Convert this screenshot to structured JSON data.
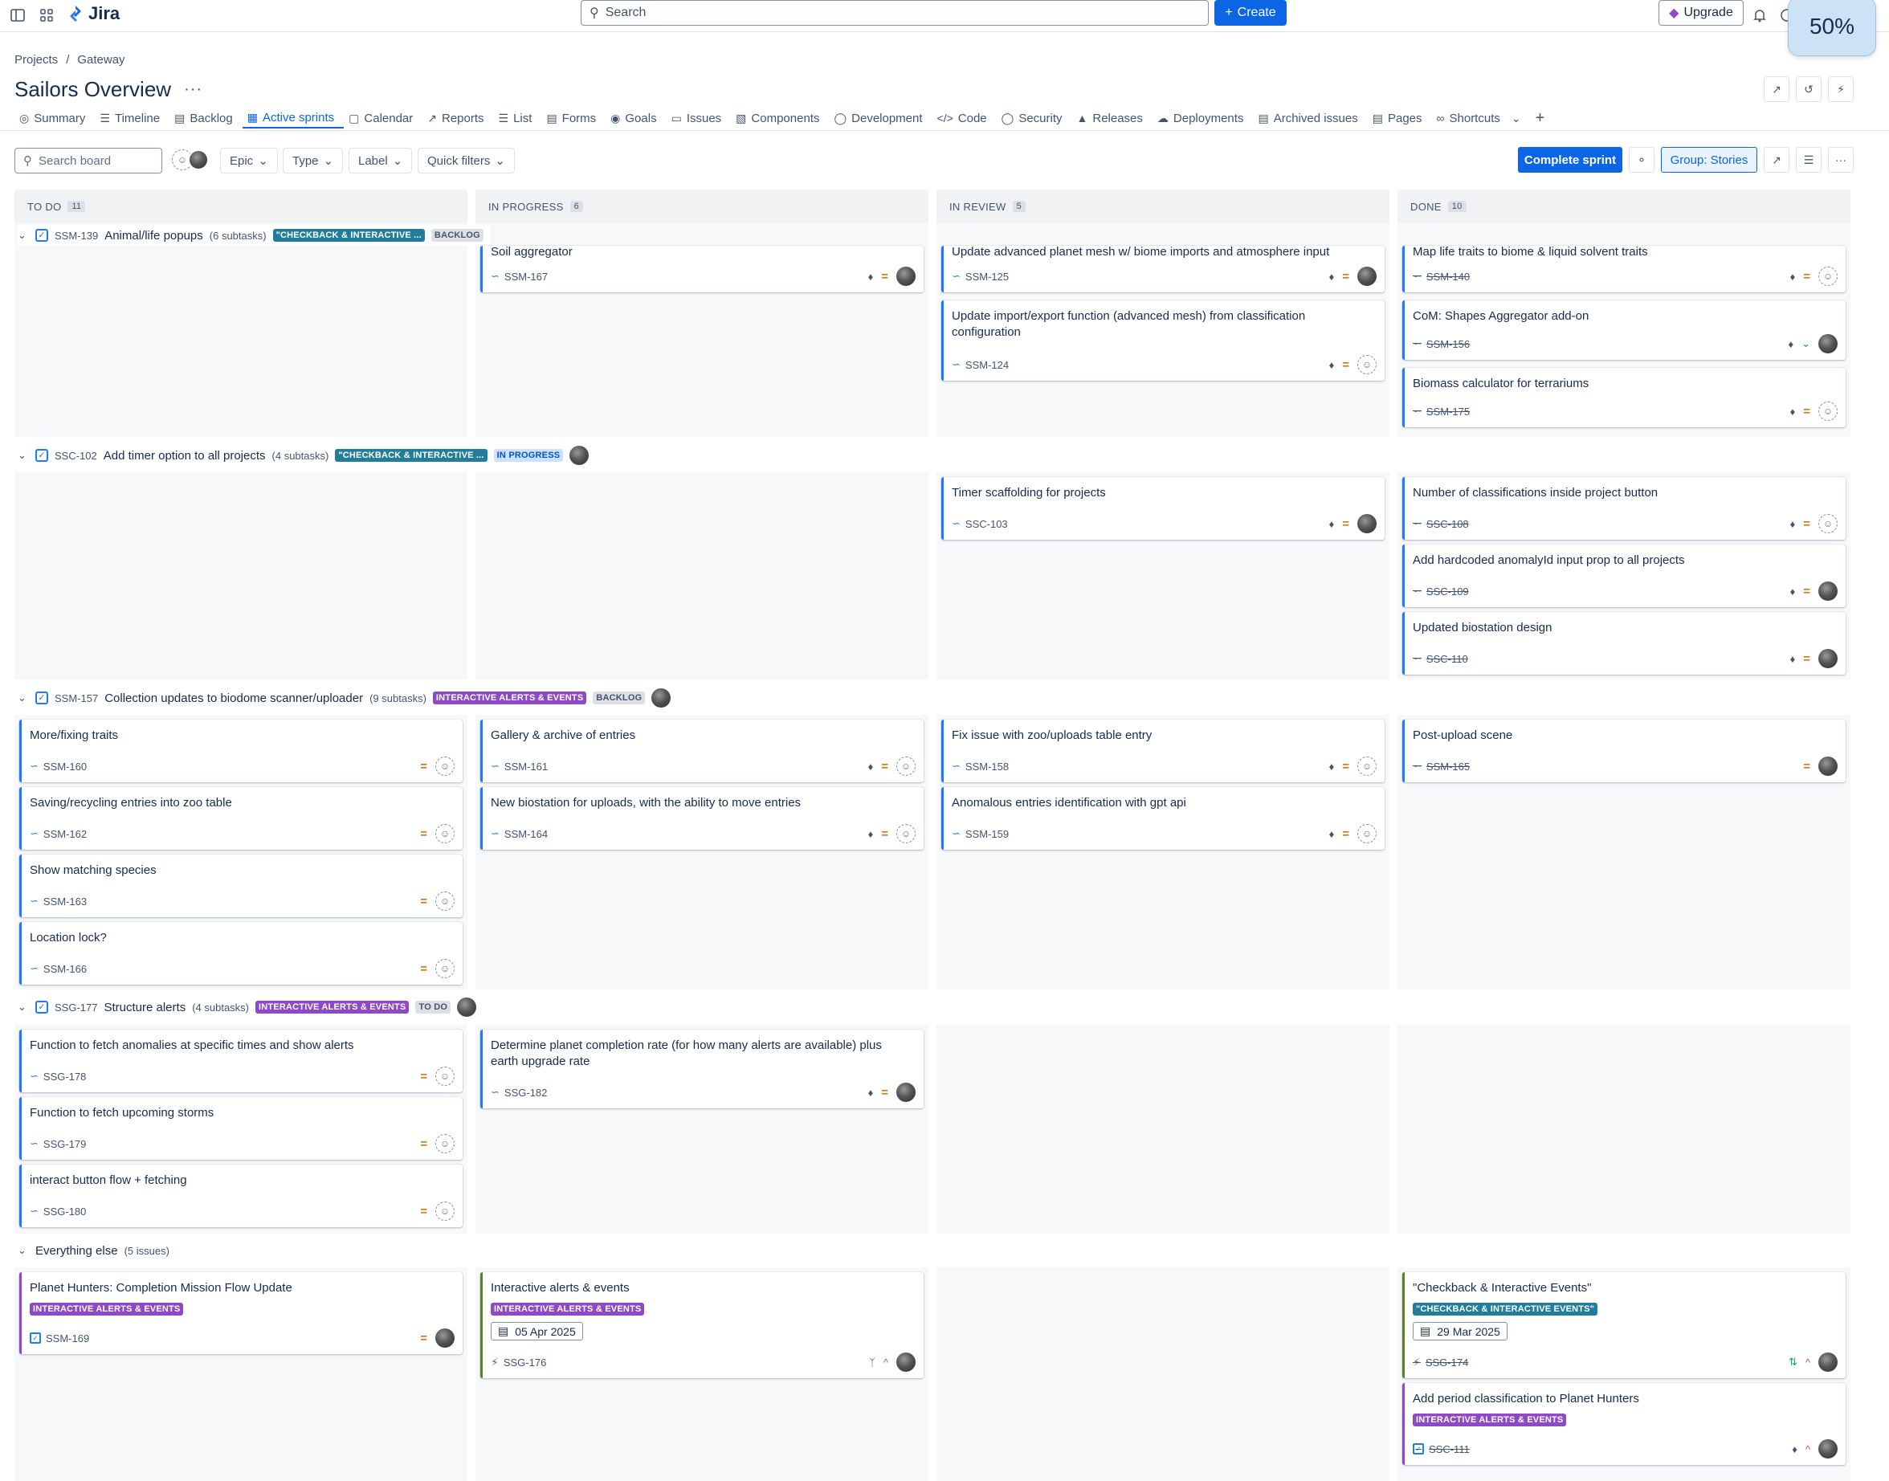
{
  "app": {
    "name": "Jira",
    "zoom": "50%"
  },
  "topnav": {
    "search_placeholder": "Search",
    "create_label": "Create",
    "upgrade_label": "Upgrade"
  },
  "breadcrumb": [
    "Projects",
    "/",
    "Gateway"
  ],
  "page_title": "Sailors Overview",
  "tabs": [
    "Summary",
    "Timeline",
    "Backlog",
    "Active sprints",
    "Calendar",
    "Reports",
    "List",
    "Forms",
    "Goals",
    "Issues",
    "Components",
    "Development",
    "Code",
    "Security",
    "Releases",
    "Deployments",
    "Archived issues",
    "Pages",
    "Shortcuts"
  ],
  "toolbar": {
    "search_placeholder": "Search board",
    "filters": [
      "Epic",
      "Type",
      "Label",
      "Quick filters"
    ],
    "complete_label": "Complete sprint",
    "group_label": "Group: Stories"
  },
  "columns": [
    {
      "name": "TO DO",
      "count": "11"
    },
    {
      "name": "IN PROGRESS",
      "count": "6"
    },
    {
      "name": "IN REVIEW",
      "count": "5"
    },
    {
      "name": "DONE",
      "count": "10"
    }
  ],
  "lanes": [
    {
      "key": "SSM-139",
      "title": "Animal/life popups",
      "subtasks": "(6 subtasks)",
      "label": "\"CHECKBACK & INTERACTIVE ...",
      "status": "BACKLOG"
    },
    {
      "key": "SSC-102",
      "title": "Add timer option to all projects",
      "subtasks": "(4 subtasks)",
      "label": "\"CHECKBACK & INTERACTIVE ...",
      "status": "IN PROGRESS"
    },
    {
      "key": "SSM-157",
      "title": "Collection updates to biodome scanner/uploader",
      "subtasks": "(9 subtasks)",
      "label": "INTERACTIVE ALERTS & EVENTS",
      "status": "BACKLOG"
    },
    {
      "key": "SSG-177",
      "title": "Structure alerts",
      "subtasks": "(4 subtasks)",
      "label": "INTERACTIVE ALERTS & EVENTS",
      "status": "TO DO"
    },
    {
      "title": "Everything else",
      "subtasks": "(5 issues)"
    }
  ],
  "cards": {
    "c1": {
      "title": "Soil aggregator",
      "key": "SSM-167"
    },
    "c2": {
      "title": "Update advanced planet mesh w/ biome imports and atmosphere input",
      "key": "SSM-125"
    },
    "c3": {
      "title": "Update import/export function (advanced mesh) from classification configuration",
      "key": "SSM-124"
    },
    "c4": {
      "title": "Map life traits to biome & liquid solvent traits",
      "key": "SSM-140"
    },
    "c5": {
      "title": "CoM: Shapes Aggregator add-on",
      "key": "SSM-156"
    },
    "c6": {
      "title": "Biomass calculator for terrariums",
      "key": "SSM-175"
    },
    "c7": {
      "title": "Timer scaffolding for projects",
      "key": "SSC-103"
    },
    "c8": {
      "title": "Number of classifications inside project button",
      "key": "SSC-108"
    },
    "c9": {
      "title": "Add hardcoded anomalyId input prop to all projects",
      "key": "SSC-109"
    },
    "c10": {
      "title": "Updated biostation design",
      "key": "SSC-110"
    },
    "c11": {
      "title": "More/fixing traits",
      "key": "SSM-160"
    },
    "c12": {
      "title": "Saving/recycling entries into zoo table",
      "key": "SSM-162"
    },
    "c13": {
      "title": "Show matching species",
      "key": "SSM-163"
    },
    "c14": {
      "title": "Location lock?",
      "key": "SSM-166"
    },
    "c15": {
      "title": "Gallery & archive of entries",
      "key": "SSM-161"
    },
    "c16": {
      "title": "New biostation for uploads, with the ability to move entries",
      "key": "SSM-164"
    },
    "c17": {
      "title": "Fix issue with zoo/uploads table entry",
      "key": "SSM-158"
    },
    "c18": {
      "title": "Anomalous entries identification with gpt api",
      "key": "SSM-159"
    },
    "c19": {
      "title": "Post-upload scene",
      "key": "SSM-165"
    },
    "c20": {
      "title": "Function to fetch anomalies at specific times and show alerts",
      "key": "SSG-178"
    },
    "c21": {
      "title": "Function to fetch upcoming storms",
      "key": "SSG-179"
    },
    "c22": {
      "title": "interact button flow + fetching",
      "key": "SSG-180"
    },
    "c23": {
      "title": "Determine planet completion rate (for how many alerts are available) plus earth upgrade rate",
      "key": "SSG-182"
    },
    "c24": {
      "title": "Planet Hunters: Completion Mission Flow Update",
      "label": "INTERACTIVE ALERTS & EVENTS",
      "key": "SSM-169"
    },
    "c25": {
      "title": "Interactive alerts & events",
      "label": "INTERACTIVE ALERTS & EVENTS",
      "date": "05 Apr 2025",
      "key": "SSG-176"
    },
    "c26": {
      "title": "\"Checkback & Interactive Events\"",
      "label": "\"CHECKBACK & INTERACTIVE EVENTS\"",
      "date": "29 Mar 2025",
      "key": "SSG-174"
    },
    "c27": {
      "title": "Add period classification to Planet Hunters",
      "label": "INTERACTIVE ALERTS & EVENTS",
      "key": "SSC-111"
    }
  },
  "colors": {
    "primary": "#0c66e4",
    "purple": "#8f48c7",
    "teal": "#227d9b",
    "medium_priority": "#e2740f"
  }
}
